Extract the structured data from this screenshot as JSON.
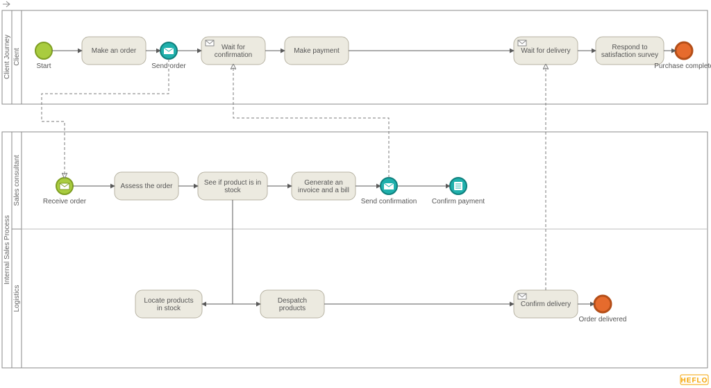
{
  "brand": "HEFLO",
  "pools": {
    "client_journey": {
      "title": "Client Journey",
      "lanes": {
        "client": "Client"
      }
    },
    "internal_sales": {
      "title": "Internal Sales Process",
      "lanes": {
        "sales_consultant": "Sales consultant",
        "logistics": "Logistics"
      }
    }
  },
  "client": {
    "start": "Start",
    "make_order": "Make an order",
    "send_order": "Send order",
    "wait_confirmation": "Wait for confirmation",
    "make_payment": "Make payment",
    "wait_delivery": "Wait for delivery",
    "respond_survey": "Respond to satisfaction survey",
    "purchase_complete": "Purchase complete"
  },
  "sales": {
    "receive_order": "Receive order",
    "assess_order": "Assess the order",
    "check_stock": "See if product is in stock",
    "generate_invoice": "Generate an invoice and a bill",
    "send_confirmation": "Send confirmation",
    "confirm_payment": "Confirm payment"
  },
  "logistics": {
    "locate_products": "Locate products in stock",
    "despatch_products": "Despatch products",
    "confirm_delivery": "Confirm delivery",
    "order_delivered": "Order delivered"
  },
  "colors": {
    "start_event": "#a9cc3f",
    "msg_throw": "#20b2aa",
    "list_event": "#20b2aa",
    "end_event": "#e66b2d",
    "task_fill": "#eceae0",
    "task_stroke": "#b7b3a3"
  }
}
